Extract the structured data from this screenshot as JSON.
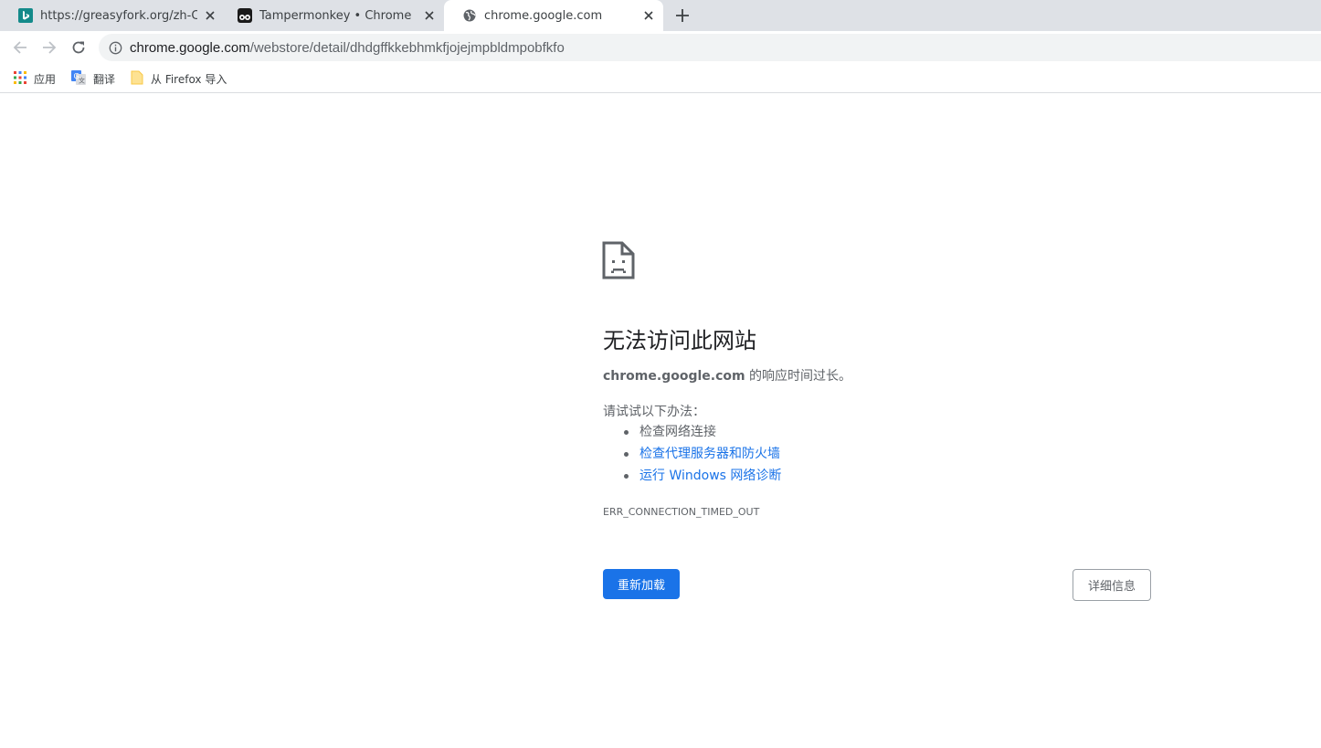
{
  "tabs": [
    {
      "title": "https://greasyfork.org/zh-CN/",
      "icon": "bing-icon",
      "active": false
    },
    {
      "title": "Tampermonkey • Chrome",
      "icon": "tampermonkey-icon",
      "active": false
    },
    {
      "title": "chrome.google.com",
      "icon": "globe-icon",
      "active": true
    }
  ],
  "toolbar": {
    "url_host": "chrome.google.com",
    "url_path": "/webstore/detail/dhdgffkkebhmkfjojejmpbldmpobfkfo"
  },
  "bookmarks": [
    {
      "label": "应用",
      "icon": "apps-grid-icon"
    },
    {
      "label": "翻译",
      "icon": "translate-icon"
    },
    {
      "label": "从 Firefox 导入",
      "icon": "folder-icon"
    }
  ],
  "error": {
    "heading": "无法访问此网站",
    "host": "chrome.google.com",
    "desc_suffix": " 的响应时间过长。",
    "suggest_title": "请试试以下办法：",
    "suggestions": [
      "检查网络连接",
      "检查代理服务器和防火墙",
      "运行 Windows 网络诊断"
    ],
    "code": "ERR_CONNECTION_TIMED_OUT",
    "reload_label": "重新加载",
    "details_label": "详细信息"
  },
  "colors": {
    "accent": "#1a73e8",
    "tabstrip": "#dee1e6",
    "text_secondary": "#5f6368"
  }
}
